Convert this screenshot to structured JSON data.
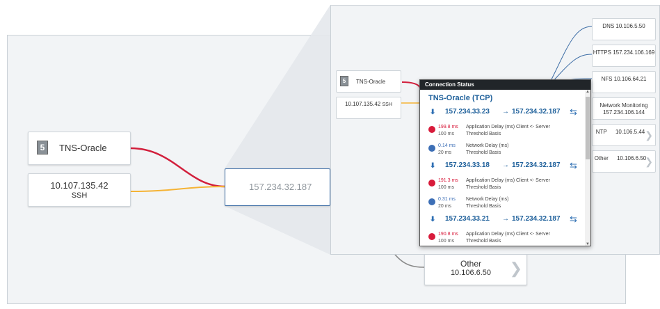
{
  "main_view": {
    "source_card": {
      "label": "TNS-Oracle",
      "icon_text": "5"
    },
    "client_card": {
      "ip": "10.107.135.42",
      "protocol": "SSH"
    },
    "target_card": {
      "ip": "157.234.32.187"
    },
    "other_card": {
      "label": "Other",
      "ip": "10.106.6.50"
    }
  },
  "detail_view": {
    "source_card": {
      "label": "TNS-Oracle",
      "icon_text": "5"
    },
    "client_card": {
      "ip": "10.107.135.42",
      "protocol": "SSH"
    },
    "destinations": [
      {
        "name": "DNS",
        "ip": "10.106.5.50"
      },
      {
        "name": "HTTPS",
        "ip": "157.234.106.169"
      },
      {
        "name": "NFS",
        "ip": "10.106.64.21"
      },
      {
        "name": "Network Monitoring",
        "ip": "157.234.106.144"
      },
      {
        "name": "NTP",
        "ip": "10.106.5.44"
      },
      {
        "name": "Other",
        "ip": "10.106.6.50"
      }
    ]
  },
  "popup": {
    "header": "Connection Status",
    "title": "TNS-Oracle (TCP)",
    "connections": [
      {
        "source_ip": "157.234.33.23",
        "arrow": "→",
        "dest_ip": "157.234.32.187",
        "metrics": [
          {
            "value": "199.8 ms",
            "threshold": "100 ms",
            "label": "Application Delay (ms) Client <- Server",
            "basis": "Threshold Basis",
            "color": "#d81b3b"
          },
          {
            "value": "0.14 ms",
            "threshold": "20 ms",
            "label": "Network Delay (ms)",
            "basis": "Threshold Basis",
            "color": "#3d6fb6"
          }
        ]
      },
      {
        "source_ip": "157.234.33.18",
        "arrow": "→",
        "dest_ip": "157.234.32.187",
        "metrics": [
          {
            "value": "191.3 ms",
            "threshold": "100 ms",
            "label": "Application Delay (ms) Client <- Server",
            "basis": "Threshold Basis",
            "color": "#d81b3b"
          },
          {
            "value": "0.31 ms",
            "threshold": "20 ms",
            "label": "Network Delay (ms)",
            "basis": "Threshold Basis",
            "color": "#3d6fb6"
          }
        ]
      },
      {
        "source_ip": "157.234.33.21",
        "arrow": "→",
        "dest_ip": "157.234.32.187",
        "metrics": [
          {
            "value": "190.8 ms",
            "threshold": "100 ms",
            "label": "Application Delay (ms) Client <- Server",
            "basis": "Threshold Basis",
            "color": "#d81b3b"
          }
        ]
      }
    ]
  },
  "colors": {
    "red_line": "#d21f3c",
    "orange_line": "#f5b335",
    "blue_line": "#3e6ea6",
    "link_blue": "#1d5f9a"
  }
}
